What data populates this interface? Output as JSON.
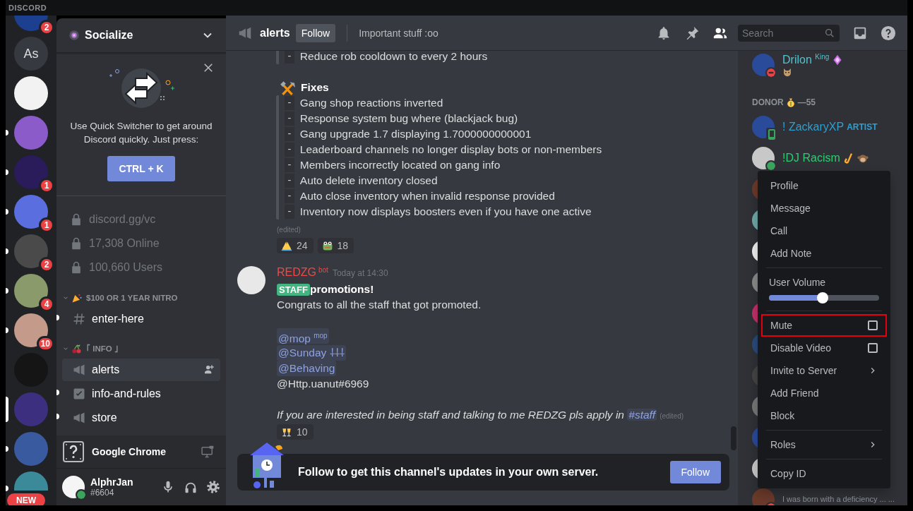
{
  "app": {
    "title": "DISCORD"
  },
  "servers": [
    {
      "kind": "image",
      "badge": "2",
      "unread": false,
      "selected": false
    },
    {
      "kind": "text",
      "label": "As",
      "unread": false,
      "selected": false
    },
    {
      "kind": "image",
      "unread": false,
      "selected": false
    },
    {
      "kind": "image",
      "unread": true,
      "selected": false
    },
    {
      "kind": "image",
      "badge": "1",
      "unread": true,
      "selected": false
    },
    {
      "kind": "image",
      "badge": "1",
      "unread": true,
      "selected": false
    },
    {
      "kind": "image",
      "badge": "2",
      "unread": true,
      "selected": false
    },
    {
      "kind": "image",
      "badge": "4",
      "unread": true,
      "selected": false
    },
    {
      "kind": "image",
      "badge": "10",
      "unread": true,
      "selected": false
    },
    {
      "kind": "image",
      "unread": false,
      "selected": false
    },
    {
      "kind": "image",
      "unread": false,
      "selected": true
    },
    {
      "kind": "image",
      "unread": true,
      "selected": false
    },
    {
      "kind": "image",
      "tag": "NEW",
      "unread": true,
      "selected": false
    }
  ],
  "server_header": {
    "name": "Socialize"
  },
  "quick_switcher": {
    "text": "Use Quick Switcher to get around Discord quickly. Just press:",
    "shortcut": "CTRL + K"
  },
  "server_info": [
    {
      "label": "discord.gg/vc"
    },
    {
      "label": "17,308 Online"
    },
    {
      "label": "100,660 Users"
    }
  ],
  "categories": [
    {
      "name": "$100 OR 1 YEAR NITRO",
      "icon": {
        "kind": "party"
      },
      "expanded": true,
      "channels": [
        {
          "kind": "text",
          "name": "enter-here",
          "unread": true,
          "selected": false
        }
      ]
    },
    {
      "name": "｢ INFO ｣",
      "icon": {
        "kind": "cherries"
      },
      "expanded": true,
      "channels": [
        {
          "kind": "announcement",
          "name": "alerts",
          "unread": false,
          "selected": true
        },
        {
          "kind": "rules",
          "name": "info-and-rules",
          "unread": true,
          "selected": false
        },
        {
          "kind": "announcement",
          "name": "store",
          "unread": true,
          "selected": false
        }
      ]
    }
  ],
  "activity": {
    "name": "Google Chrome"
  },
  "user": {
    "name": "AlphrJan",
    "tag": "#6604",
    "status": {
      "kind": "online"
    }
  },
  "channel_header": {
    "name": "alerts",
    "follow": "Follow",
    "topic": "Important stuff :oo",
    "search_placeholder": "Search"
  },
  "messages": [
    {
      "kind": "continuation",
      "blocks": [
        {
          "kind": "quote",
          "items": [
            {
              "bullet": "-",
              "text": "Reduce rob cooldown to every 2 hours"
            }
          ]
        },
        {
          "kind": "spacer"
        },
        {
          "kind": "heading",
          "icon": {
            "kind": "tools"
          },
          "text": "Fixes"
        },
        {
          "kind": "quote",
          "items": [
            {
              "bullet": "-",
              "text": "Gang shop reactions inverted"
            },
            {
              "bullet": "-",
              "text": "Response system bug where (blackjack bug)"
            },
            {
              "bullet": "-",
              "text": "Gang upgrade 1.7 displaying 1.7000000000001"
            },
            {
              "bullet": "-",
              "text": "Leaderboard channels no longer display bots or non-members"
            },
            {
              "bullet": "-",
              "text": "Members incorrectly located on gang info"
            },
            {
              "bullet": "-",
              "text": "Auto delete inventory closed"
            },
            {
              "bullet": "-",
              "text": "Auto close inventory when invalid response provided"
            },
            {
              "bullet": "-",
              "text": "Inventory now displays boosters even if you have one active"
            }
          ]
        },
        {
          "kind": "edited",
          "text": "(edited)"
        }
      ],
      "reactions": [
        {
          "icon": {
            "kind": "pray"
          },
          "count": "24"
        },
        {
          "icon": {
            "kind": "frog"
          },
          "count": "18"
        }
      ]
    },
    {
      "kind": "full",
      "author": "REDZG",
      "author_tag": "bot",
      "time": "Today at 14:30",
      "blocks": [
        {
          "kind": "title",
          "tag": "STAFF",
          "text": "promotions!"
        },
        {
          "kind": "plain",
          "text": "Congrats to all the staff that got promoted."
        },
        {
          "kind": "spacer"
        },
        {
          "kind": "mention",
          "text": "@mop $^{mop}$"
        },
        {
          "kind": "mention",
          "text": "@Sunday ⸸⸸⸸"
        },
        {
          "kind": "mention",
          "text": "@Behaving"
        },
        {
          "kind": "plain",
          "text": "@Http.uanut#6969"
        },
        {
          "kind": "spacer"
        },
        {
          "kind": "italic",
          "text": "If you are interested in being staff and talking to me REDZG pls apply in ",
          "channel": "#staff",
          "edited": "(edited)"
        }
      ],
      "reactions": [
        {
          "icon": {
            "kind": "cheers"
          },
          "count": "10"
        }
      ]
    }
  ],
  "follow_banner": {
    "text": "Follow to get this channel's updates in your own server.",
    "button": "Follow"
  },
  "member_groups": [
    {
      "members": [
        {
          "kind": "full",
          "name": "Drilon $^{King}$",
          "color": "#4fc4cf",
          "status": {
            "kind": "dnd"
          },
          "badges": [
            {
              "kind": "gem"
            }
          ],
          "status_icon": {
            "kind": "cat"
          }
        }
      ]
    },
    {
      "title": "DONOR",
      "icon": {
        "kind": "moneybag"
      },
      "count": "—55",
      "members": [
        {
          "kind": "full",
          "name": "! ZackaryXP",
          "tag": "ARTIST",
          "color": "#2e9fd0",
          "status": {
            "kind": "mobile"
          }
        },
        {
          "kind": "full",
          "name": "!DJ Racism",
          "color": "#2ecc71",
          "status": {
            "kind": "online"
          },
          "badges": [
            {
              "kind": "sax"
            },
            {
              "kind": "monkey"
            }
          ]
        },
        {
          "kind": "obscured"
        },
        {
          "kind": "obscured"
        },
        {
          "kind": "obscured"
        },
        {
          "kind": "obscured"
        },
        {
          "kind": "obscured"
        },
        {
          "kind": "obscured"
        },
        {
          "kind": "obscured"
        },
        {
          "kind": "obscured"
        },
        {
          "kind": "obscured"
        },
        {
          "kind": "obscured"
        },
        {
          "kind": "activity_only",
          "activity": "I was born with a deficiency ... ...",
          "status": {
            "kind": "dnd"
          }
        }
      ]
    }
  ],
  "context_menu": {
    "sections": [
      [
        {
          "kind": "item",
          "label": "Profile"
        },
        {
          "kind": "item",
          "label": "Message"
        },
        {
          "kind": "item",
          "label": "Call"
        },
        {
          "kind": "item",
          "label": "Add Note"
        }
      ],
      [
        {
          "kind": "slider",
          "label": "User Volume",
          "level": 0.49
        }
      ],
      [
        {
          "kind": "checkbox",
          "label": "Mute",
          "checked": false,
          "highlighted": true
        },
        {
          "kind": "checkbox",
          "label": "Disable Video",
          "checked": false,
          "highlighted": false
        },
        {
          "kind": "submenu",
          "label": "Invite to Server"
        },
        {
          "kind": "item",
          "label": "Add Friend"
        },
        {
          "kind": "item",
          "label": "Block"
        }
      ],
      [
        {
          "kind": "submenu",
          "label": "Roles"
        }
      ],
      [
        {
          "kind": "item",
          "label": "Copy ID"
        }
      ]
    ]
  }
}
